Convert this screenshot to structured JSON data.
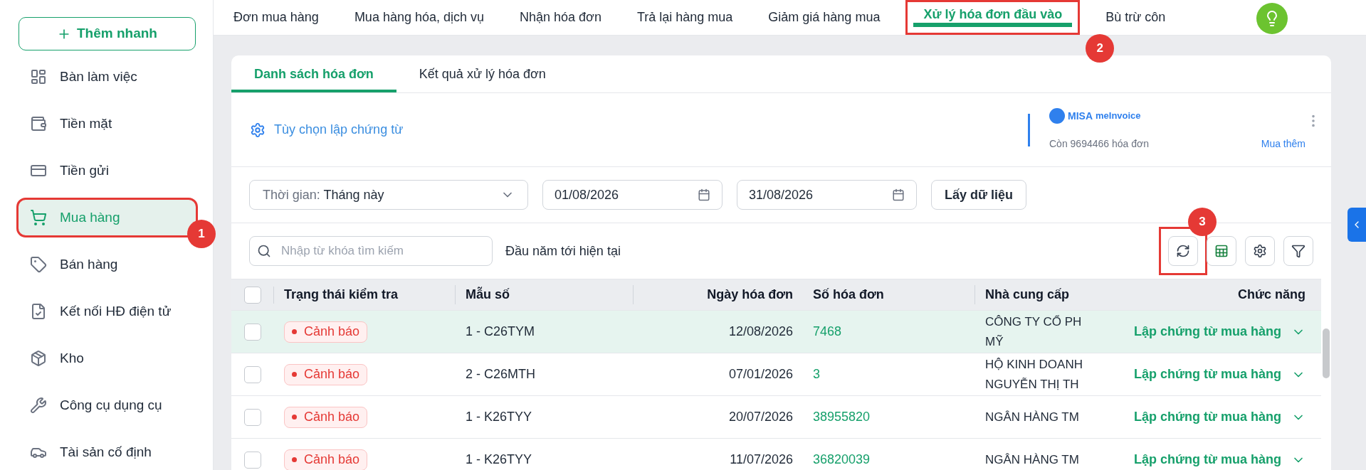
{
  "sidebar": {
    "quick_add": "Thêm nhanh",
    "items": [
      {
        "label": "Bàn làm việc",
        "selected": false
      },
      {
        "label": "Tiền mặt",
        "selected": false
      },
      {
        "label": "Tiền gửi",
        "selected": false
      },
      {
        "label": "Mua hàng",
        "selected": true,
        "annotated": true,
        "callout": "1"
      },
      {
        "label": "Bán hàng",
        "selected": false
      },
      {
        "label": "Kết nối HĐ điện tử",
        "selected": false
      },
      {
        "label": "Kho",
        "selected": false
      },
      {
        "label": "Công cụ dụng cụ",
        "selected": false
      },
      {
        "label": "Tài sản cố định",
        "selected": false
      }
    ]
  },
  "top_tabs": [
    {
      "label": "Đơn mua hàng",
      "selected": false
    },
    {
      "label": "Mua hàng hóa, dịch vụ",
      "selected": false
    },
    {
      "label": "Nhận hóa đơn",
      "selected": false
    },
    {
      "label": "Trả lại hàng mua",
      "selected": false
    },
    {
      "label": "Giảm giá hàng mua",
      "selected": false
    },
    {
      "label": "Xử lý hóa đơn đầu vào",
      "selected": true,
      "annotated": true,
      "callout": "2"
    },
    {
      "label": "Bù trừ côn",
      "selected": false
    }
  ],
  "card_tabs": [
    {
      "label": "Danh sách hóa đơn",
      "selected": true
    },
    {
      "label": "Kết quả xử lý hóa đơn",
      "selected": false
    }
  ],
  "options_link": "Tùy chọn lập chứng từ",
  "invoice_service": {
    "brand": "MISA",
    "product": "meInvoice",
    "remaining": "Còn 9694466 hóa đơn",
    "buy_more": "Mua thêm"
  },
  "filters": {
    "period_label": "Thời gian:",
    "period_value": "Tháng này",
    "from": "01/08/2026",
    "to": "31/08/2026",
    "fetch_button": "Lấy dữ liệu"
  },
  "search": {
    "placeholder": "Nhập từ khóa tìm kiếm",
    "range_label": "Đầu năm tới hiện tại"
  },
  "toolbar": [
    {
      "kind": "refresh",
      "annotated": true,
      "callout": "3"
    },
    {
      "kind": "excel",
      "annotated": false
    },
    {
      "kind": "settings",
      "annotated": false
    },
    {
      "kind": "filter",
      "annotated": false
    }
  ],
  "table": {
    "select_all_checked": false,
    "columns": [
      "Trạng thái kiểm tra",
      "Mẫu số",
      "Ngày hóa đơn",
      "Số hóa đơn",
      "Nhà cung cấp",
      "Chức năng"
    ],
    "rows": [
      {
        "selected": true,
        "checked": false,
        "status": "Cảnh báo",
        "template": "1 - C26TYM",
        "date": "12/08/2026",
        "number": "7468",
        "supplier": [
          "CÔNG TY CỔ PH",
          "MỸ"
        ],
        "action": "Lập chứng từ mua hàng"
      },
      {
        "selected": false,
        "checked": false,
        "status": "Cảnh báo",
        "template": "2 - C26MTH",
        "date": "07/01/2026",
        "number": "3",
        "supplier": [
          "HỘ KINH DOANH",
          "NGUYỄN THỊ TH"
        ],
        "action": "Lập chứng từ mua hàng"
      },
      {
        "selected": false,
        "checked": false,
        "status": "Cảnh báo",
        "template": "1 - K26TYY",
        "date": "20/07/2026",
        "number": "38955820",
        "supplier": [
          "NGÂN HÀNG TM"
        ],
        "action": "Lập chứng từ mua hàng"
      },
      {
        "selected": false,
        "checked": false,
        "status": "Cảnh báo",
        "template": "1 - K26TYY",
        "date": "11/07/2026",
        "number": "36820039",
        "supplier": [
          "NGÂN HÀNG TM"
        ],
        "action": "Lập chứng từ mua hàng"
      }
    ]
  }
}
